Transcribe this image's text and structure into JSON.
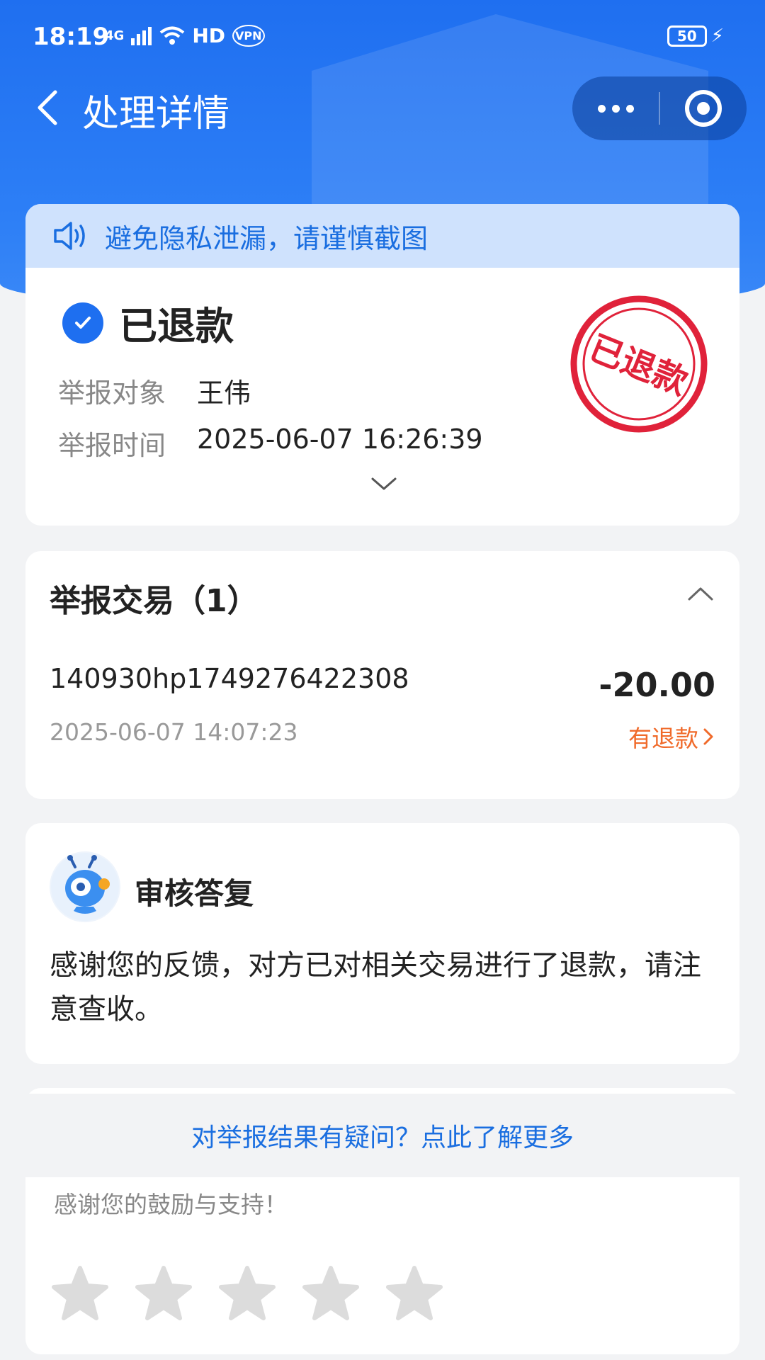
{
  "status_bar": {
    "time": "18:19",
    "network": "4G",
    "hd": "HD",
    "vpn": "VPN",
    "battery": "50"
  },
  "nav": {
    "title": "处理详情",
    "back_icon": "chevron-left-icon",
    "more_icon": "more-dots-icon",
    "close_icon": "target-close-icon"
  },
  "notice": {
    "text": "避免隐私泄漏，请谨慎截图",
    "icon": "speaker-icon"
  },
  "status": {
    "title": "已退款",
    "icon": "check-circle-icon",
    "rows": [
      {
        "label": "举报对象",
        "value": "王伟"
      },
      {
        "label": "举报时间",
        "value": "2025-06-07 16:26:39"
      }
    ],
    "stamp_text": "已退款",
    "stamp_color": "#e0223a"
  },
  "trade": {
    "header": "举报交易（1）",
    "id": "140930hp1749276422308",
    "time": "2025-06-07 14:07:23",
    "amount": "-20.00",
    "refund_label": "有退款",
    "refund_color": "#f06a2a"
  },
  "reply": {
    "title": "审核答复",
    "body": "感谢您的反馈，对方已对相关交易进行了退款，请注意查收。",
    "avatar_icon": "robot-mascot-icon"
  },
  "help_link": "对举报结果有疑问？点此了解更多",
  "rating": {
    "text": "感谢您的鼓励与支持！",
    "stars": 5,
    "selected": 0
  },
  "colors": {
    "primary": "#1e6ff0",
    "link": "#1a6ee0",
    "notice_bg": "#cfe2fd"
  }
}
